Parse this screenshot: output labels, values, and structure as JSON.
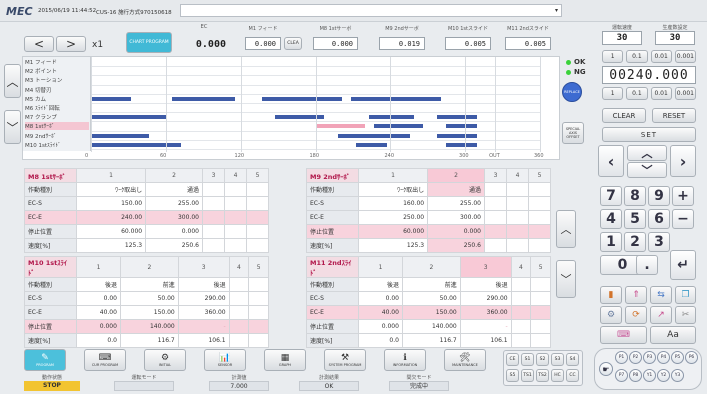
{
  "header": {
    "logo": "MEC",
    "datetime": "2015/06/19 11:44:52",
    "machine": "CUS-16 施行方式970150618",
    "ec_label": "EC",
    "ec_value": "0.000",
    "chart_btn": "CHART PROGRAM",
    "x1": "x1",
    "small_left": "<",
    ">": ">",
    "small_right": ">"
  },
  "top_fields": [
    {
      "label": "M1 フィード",
      "value": "0.000"
    },
    {
      "label": "M8 1stサーボ",
      "value": "0.000"
    },
    {
      "label": "M9 2ndサーボ",
      "value": "0.019"
    },
    {
      "label": "M10 1stスライド",
      "value": "0.005"
    },
    {
      "label": "M11 2ndスライド",
      "value": "0.005"
    }
  ],
  "clear_small": "CLEA",
  "chart": {
    "rows": [
      "M1 フィード",
      "M2 ボイント",
      "M3 トーション",
      "M4 切替刃",
      "M5 カム",
      "M6 ｽﾗｲﾄﾞ回転",
      "M7 クランプ",
      "M8 1stｻｰﾎﾞ",
      "M9 2ndｻｰﾎﾞ",
      "M10 1stｽﾗｲﾄﾞ"
    ],
    "ticks": [
      "0",
      "60",
      "120",
      "180",
      "240",
      "300",
      "OUT",
      "360"
    ],
    "bars": [
      [],
      [],
      [],
      [],
      [
        [
          0.0,
          0.09
        ],
        [
          0.18,
          0.32
        ],
        [
          0.38,
          0.56
        ],
        [
          0.58,
          0.78
        ]
      ],
      [],
      [
        [
          0.0,
          0.17
        ],
        [
          0.41,
          0.52
        ],
        [
          0.62,
          0.72
        ],
        [
          0.77,
          0.86
        ]
      ],
      [
        [
          0.5,
          0.61
        ],
        [
          0.63,
          0.74
        ],
        [
          0.79,
          0.86
        ]
      ],
      [
        [
          0.0,
          0.13
        ],
        [
          0.55,
          0.71
        ],
        [
          0.77,
          0.86
        ]
      ],
      [
        [
          0.0,
          0.2
        ],
        [
          0.59,
          0.66
        ],
        [
          0.79,
          0.86
        ]
      ]
    ]
  },
  "status": {
    "ok": "OK",
    "ng": "NG",
    "replace": "REPLACE",
    "special": "SPECIAL AXIS OFFSET"
  },
  "counters": {
    "left_label": "運転速度",
    "right_label": "生産数設定",
    "left_value": "30",
    "right_value": "30",
    "big_value": "00240.000",
    "steps": [
      "1",
      "0.1",
      "0.01",
      "0.001"
    ],
    "clear": "CLEAR",
    "reset": "RESET",
    "set": "SET"
  },
  "keypad": [
    "7",
    "8",
    "9",
    "+",
    "4",
    "5",
    "6",
    "−",
    "1",
    "2",
    "3",
    "0",
    "."
  ],
  "tables": [
    {
      "title": "M8 1stｻｰﾎﾞ",
      "cols": [
        "1",
        "2",
        "3",
        "4",
        "5"
      ],
      "rows": [
        [
          "作動種別",
          "ﾜｰｸ取出し",
          "通過",
          "",
          "",
          ""
        ],
        [
          "EC-S",
          "150.00",
          "255.00",
          "",
          "",
          ""
        ],
        [
          "EC-E",
          "240.00",
          "300.00",
          "",
          "",
          ""
        ],
        [
          "停止位置",
          "60.000",
          "0.000",
          "",
          "",
          ""
        ],
        [
          "速度[%]",
          "125.3",
          "250.6",
          "",
          "",
          ""
        ]
      ]
    },
    {
      "title": "M9 2ndｻｰﾎﾞ",
      "cols": [
        "1",
        "2",
        "3",
        "4",
        "5"
      ],
      "rows": [
        [
          "作動種別",
          "ﾜｰｸ取出し",
          "通過",
          "",
          "",
          ""
        ],
        [
          "EC-S",
          "160.00",
          "255.00",
          "",
          "",
          ""
        ],
        [
          "EC-E",
          "250.00",
          "300.00",
          "",
          "",
          ""
        ],
        [
          "停止位置",
          "60.000",
          "0.000",
          "",
          "",
          ""
        ],
        [
          "速度[%]",
          "125.3",
          "250.6",
          "",
          "",
          ""
        ]
      ]
    },
    {
      "title": "M10 1stｽﾗｲﾄﾞ",
      "cols": [
        "1",
        "2",
        "3",
        "4",
        "5"
      ],
      "rows": [
        [
          "作動種別",
          "後退",
          "前進",
          "後退",
          "",
          ""
        ],
        [
          "EC-S",
          "0.00",
          "50.00",
          "290.00",
          "",
          ""
        ],
        [
          "EC-E",
          "40.00",
          "150.00",
          "360.00",
          "",
          ""
        ],
        [
          "停止位置",
          "0.000",
          "140.000",
          "-",
          "",
          ""
        ],
        [
          "速度[%]",
          "0.0",
          "116.7",
          "106.1",
          "",
          ""
        ]
      ]
    },
    {
      "title": "M11 2ndｽﾗｲﾄﾞ",
      "cols": [
        "1",
        "2",
        "3",
        "4",
        "5"
      ],
      "rows": [
        [
          "作動種別",
          "後退",
          "前進",
          "後退",
          "",
          ""
        ],
        [
          "EC-S",
          "0.00",
          "50.00",
          "290.00",
          "",
          ""
        ],
        [
          "EC-E",
          "40.00",
          "150.00",
          "360.00",
          "",
          ""
        ],
        [
          "停止位置",
          "0.000",
          "140.000",
          "-",
          "",
          ""
        ],
        [
          "速度[%]",
          "0.0",
          "116.7",
          "106.1",
          "",
          ""
        ]
      ]
    }
  ],
  "tabs": [
    "PROGRAM",
    "CUR PROGRAM",
    "INITIAL",
    "SENSOR",
    "GRAPH",
    "SYSTEM PROGRAM",
    "INFORMATION",
    "MAINTENANCE"
  ],
  "bottom": {
    "status_label": "動作状態",
    "status_value": "STOP",
    "mode_label": "運転モード",
    "mode_value": "",
    "counter_label": "計測値",
    "counter_value": "7.000",
    "judge_label": "計測結果",
    "judge_value": "OK",
    "extra_label": "間欠モード",
    "extra_value": "完成中"
  },
  "ce_keys": [
    "CE",
    "S1",
    "S2",
    "S3",
    "S4",
    "S5",
    "TS1",
    "TS2",
    "HC",
    "CC"
  ],
  "p_keys": [
    "P1",
    "P2",
    "P3",
    "P4",
    "P5",
    "P6",
    "P7",
    "P8",
    "Y1",
    "Y2",
    "Y3"
  ]
}
